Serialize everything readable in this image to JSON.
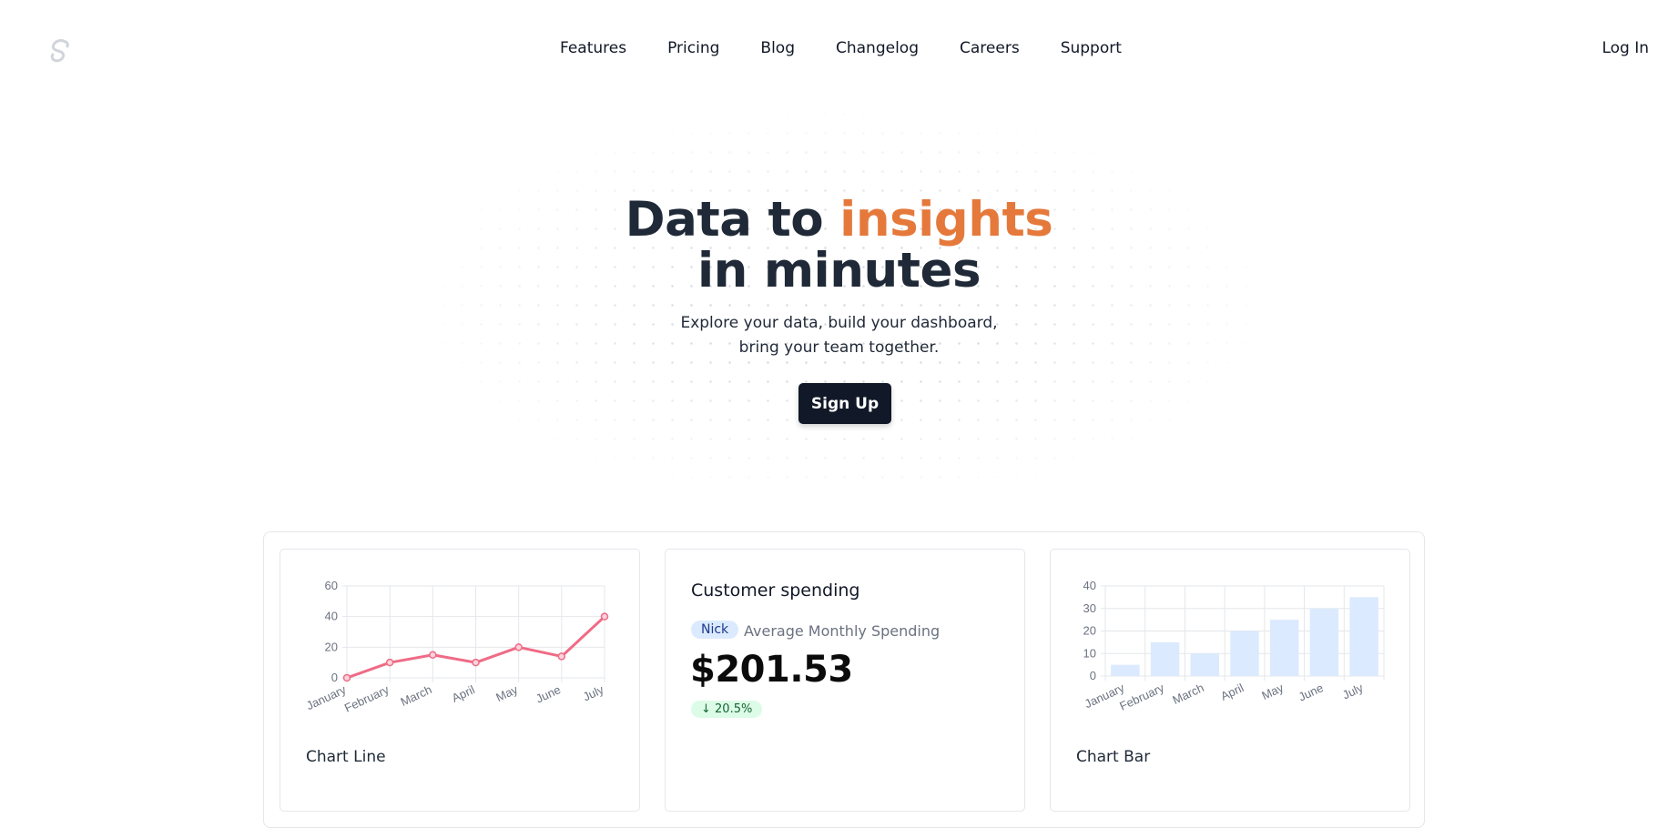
{
  "nav": {
    "logo_icon": "svelte-logo-icon",
    "links": [
      "Features",
      "Pricing",
      "Blog",
      "Changelog",
      "Careers",
      "Support"
    ],
    "login": "Log In"
  },
  "hero": {
    "title_part1": "Data to ",
    "title_accent": "insights",
    "title_line2": "in minutes",
    "subtitle_line1": "Explore your data, build your dashboard,",
    "subtitle_line2": "bring your team together.",
    "cta": "Sign Up",
    "accent_color": "#e5793b"
  },
  "cards": {
    "line_label": "Chart Line",
    "bar_label": "Chart Bar",
    "spending": {
      "title": "Customer spending",
      "badge": "Nick",
      "caption": "Average Monthly Spending",
      "value": "$201.53",
      "delta": "↓ 20.5%"
    }
  },
  "chart_data": [
    {
      "type": "line",
      "categories": [
        "January",
        "February",
        "March",
        "April",
        "May",
        "June",
        "July"
      ],
      "values": [
        0,
        10,
        15,
        10,
        20,
        14,
        40
      ],
      "yticks": [
        0,
        20,
        40,
        60
      ],
      "ylim": [
        0,
        60
      ],
      "color": "#ef6b86",
      "grid": true
    },
    {
      "type": "bar",
      "categories": [
        "January",
        "February",
        "March",
        "April",
        "May",
        "June",
        "July"
      ],
      "values": [
        5,
        15,
        10,
        20,
        25,
        30,
        35
      ],
      "yticks": [
        0,
        10,
        20,
        30,
        40
      ],
      "ylim": [
        0,
        40
      ],
      "color": "#dbeafe",
      "grid": true
    }
  ]
}
